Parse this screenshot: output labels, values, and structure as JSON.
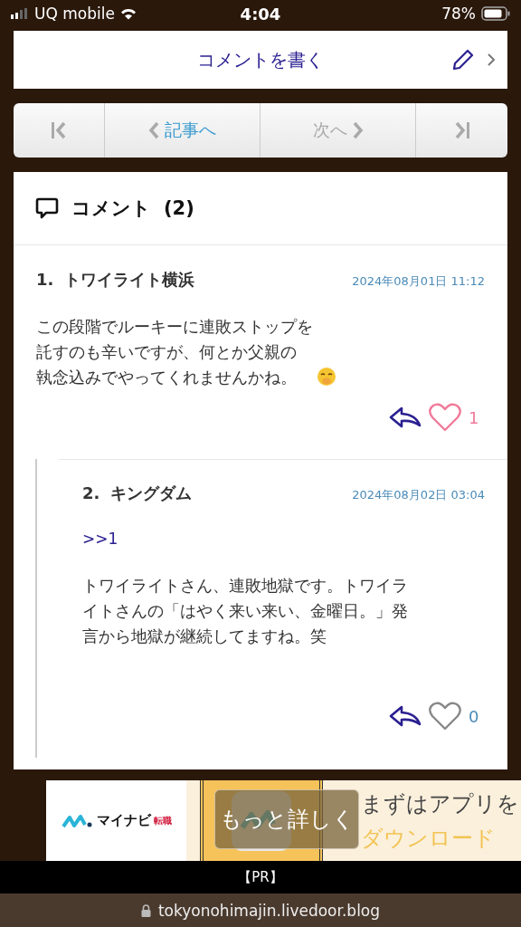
{
  "status_bar": {
    "carrier": "UQ mobile",
    "time": "4:04",
    "battery": "78%"
  },
  "write_comment": {
    "label": "コメントを書く"
  },
  "pager": [
    {
      "kind": "first",
      "disabled": true
    },
    {
      "kind": "prev",
      "label": "記事へ",
      "disabled": false
    },
    {
      "kind": "next",
      "label": "次へ",
      "disabled": true
    },
    {
      "kind": "last",
      "disabled": true
    }
  ],
  "comments_section": {
    "title": "コメント",
    "count": "(2)"
  },
  "comments": [
    {
      "number": "1.",
      "name": "トワイライト横浜",
      "date": "2024年08月01日 11:12",
      "lines": [
        "この段階でルーキーに連敗ストップを",
        "託すのも辛いですが、何とか父親の",
        "執念込みでやってくれませんかね。"
      ],
      "emoji": true,
      "liked": true,
      "likes": "1",
      "nested": false
    },
    {
      "number": "2.",
      "name": "キングダム",
      "date": "2024年08月02日 03:04",
      "reply_to": ">>1",
      "lines": [
        "トワイライトさん、連敗地獄です。トワイラ",
        "イトさんの「はやく来い来い、金曜日。」発",
        "言から地獄が継続してますね。笑"
      ],
      "emoji": false,
      "liked": false,
      "likes": "0",
      "nested": true
    }
  ],
  "ad": {
    "brand": "マイナビ",
    "brand_sub": "転職",
    "button": "もっと詳しく",
    "headline": "まずはアプリを",
    "cta": "ダウンロード",
    "label": "【PR】"
  },
  "address_bar": {
    "url": "tokyonohimajin.livedoor.blog"
  }
}
